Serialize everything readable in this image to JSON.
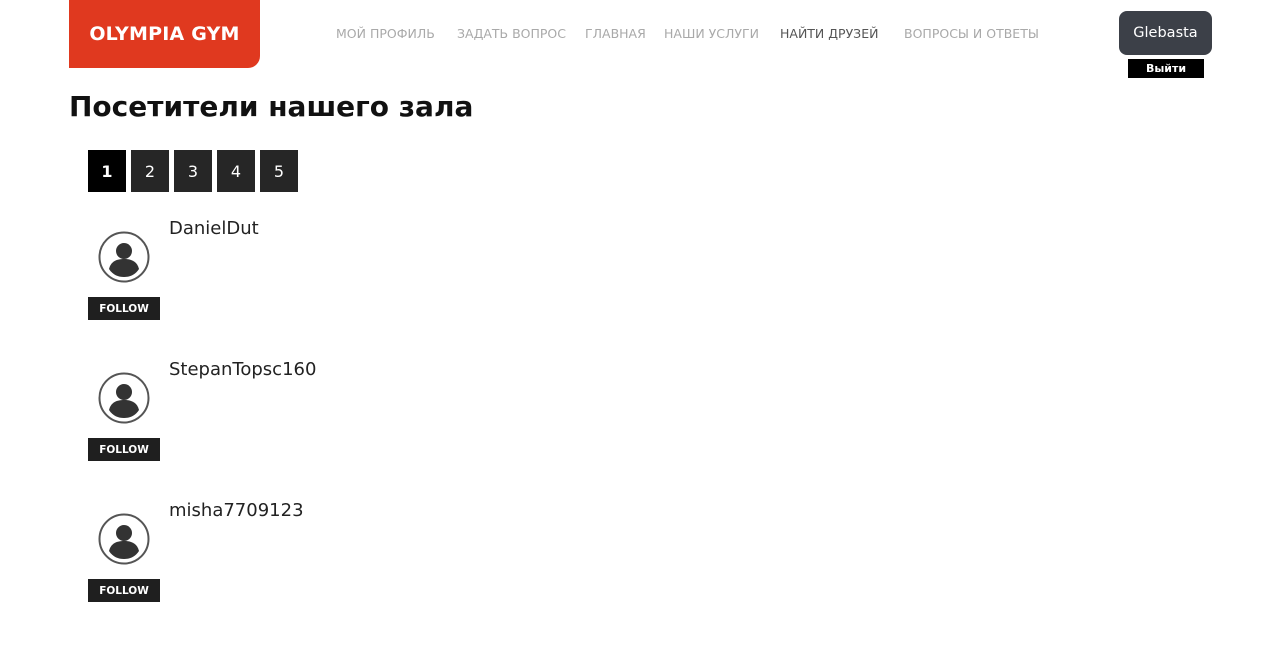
{
  "header": {
    "logo": "OLYMPIA GYM",
    "nav": [
      {
        "label": "МОЙ ПРОФИЛЬ"
      },
      {
        "label": "ЗАДАТЬ ВОПРОС"
      },
      {
        "label": "ГЛАВНАЯ"
      },
      {
        "label": "НАШИ УСЛУГИ"
      },
      {
        "label": "НАЙТИ ДРУЗЕЙ",
        "active": true
      },
      {
        "label": "ВОПРОСЫ И ОТВЕТЫ"
      }
    ],
    "user_name": "Glebasta",
    "logout_label": "Выйти"
  },
  "main": {
    "title": "Посетители нашего зала",
    "pagination": {
      "pages": [
        "1",
        "2",
        "3",
        "4",
        "5"
      ],
      "current": "1"
    },
    "users": [
      {
        "name": "DanielDut",
        "follow_label": "FOLLOW"
      },
      {
        "name": "StepanTopsc160",
        "follow_label": "FOLLOW"
      },
      {
        "name": "misha7709123",
        "follow_label": "FOLLOW"
      }
    ],
    "avatar_icon": "user-circle-icon"
  },
  "colors": {
    "brand": "#e0391f",
    "user_button": "#3c4048",
    "dark_button": "#1f1f1f",
    "nav_text": "#a9a9a9"
  }
}
